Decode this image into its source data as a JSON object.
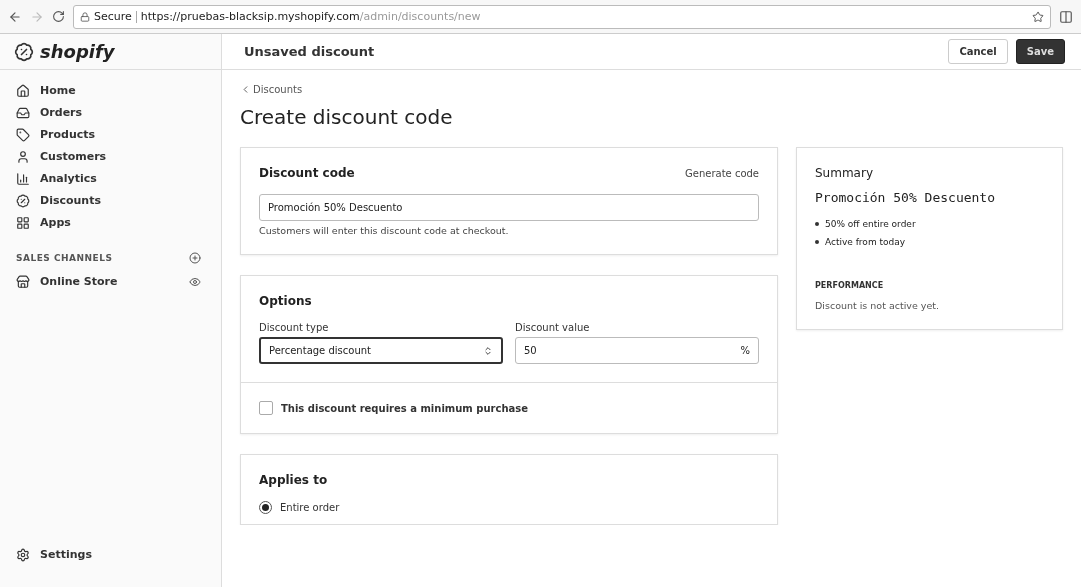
{
  "browser": {
    "secure_label": "Secure",
    "url_host": "https://pruebas-blacksip.myshopify.com",
    "url_path": "/admin/discounts/new"
  },
  "logo": "shopify",
  "header": {
    "title": "Unsaved discount",
    "buttons": [
      {
        "label": "Cancel",
        "kind": "secondary"
      },
      {
        "label": "Save",
        "kind": "primary"
      }
    ]
  },
  "sidebar": {
    "items": [
      {
        "label": "Home"
      },
      {
        "label": "Orders"
      },
      {
        "label": "Products"
      },
      {
        "label": "Customers"
      },
      {
        "label": "Analytics"
      },
      {
        "label": "Discounts"
      },
      {
        "label": "Apps"
      }
    ],
    "section_title": "SALES CHANNELS",
    "channels": [
      {
        "label": "Online Store"
      }
    ],
    "settings": "Settings"
  },
  "breadcrumb": "Discounts",
  "page_title": "Create discount code",
  "discount_code": {
    "title": "Discount code",
    "action": "Generate code",
    "value": "Promoción 50% Descuento",
    "help": "Customers will enter this discount code at checkout."
  },
  "options": {
    "title": "Options",
    "type_label": "Discount type",
    "type_value": "Percentage discount",
    "value_label": "Discount value",
    "value": "50",
    "suffix": "%",
    "minimum": {
      "label": "This discount requires a minimum purchase",
      "checked": false
    }
  },
  "applies_to": {
    "title": "Applies to",
    "choices": [
      {
        "label": "Entire order",
        "selected": true
      }
    ]
  },
  "summary": {
    "title": "Summary",
    "code": "Promoción 50% Descuento",
    "bullets": [
      "50% off entire order",
      "Active from today"
    ],
    "performance_title": "PERFORMANCE",
    "performance_text": "Discount is not active yet."
  }
}
